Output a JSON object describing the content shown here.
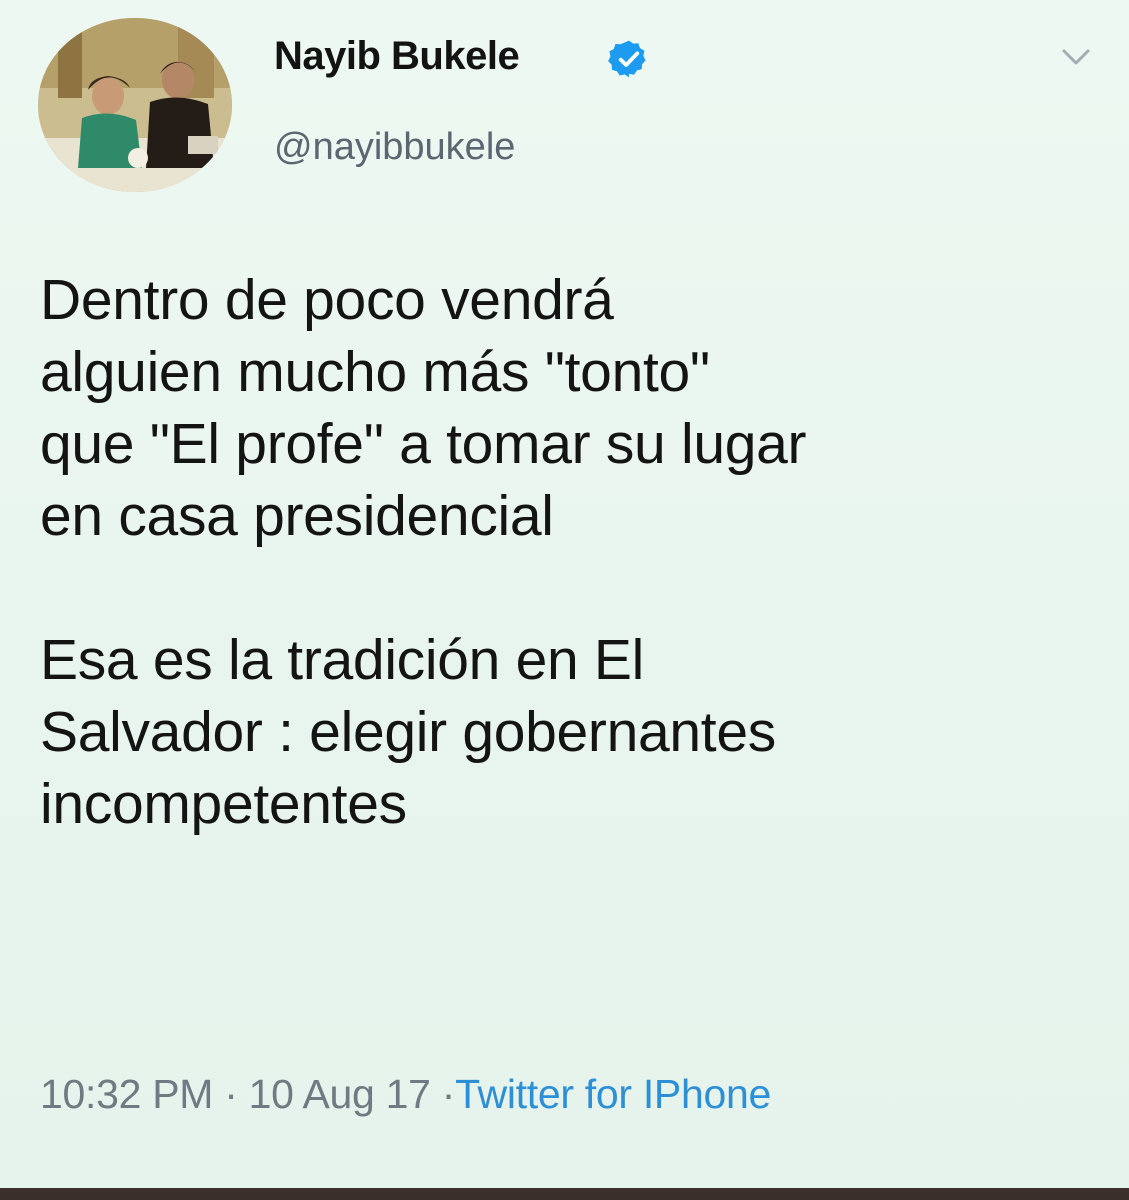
{
  "user": {
    "name": "Nayib Bukele",
    "handle": "@nayibbukele",
    "verified": true
  },
  "tweet": {
    "text": "Dentro de poco vendrá\nalguien mucho más \"tonto\"\nque \"El profe\" a tomar su lugar\nen casa presidencial\n\nEsa es la tradición en El\nSalvador : elegir gobernantes\nincompetentes",
    "time": "10:32 PM",
    "separator": "·",
    "date": "10 Aug 17",
    "source": "Twitter for IPhone"
  },
  "icons": {
    "verified": "verified-badge-icon",
    "menu": "chevron-down-icon"
  },
  "colors": {
    "background": "#eaf5ef",
    "link": "#2d8fd6",
    "verified": "#1d9bf0",
    "meta": "#6f7a82"
  }
}
